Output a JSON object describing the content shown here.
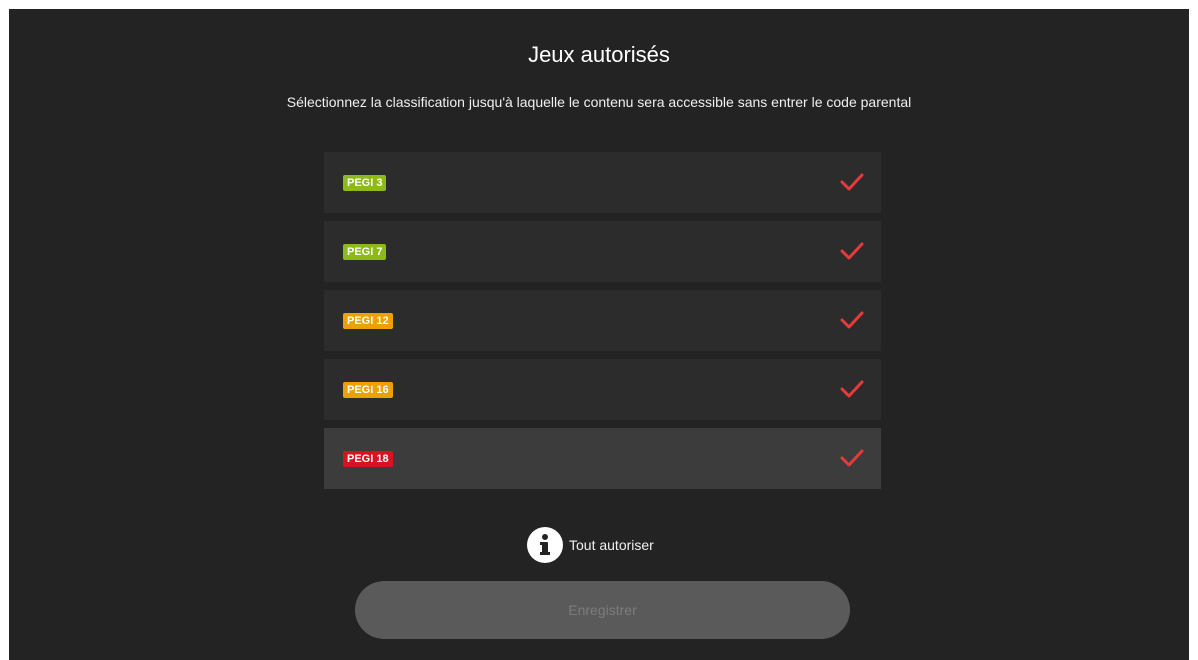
{
  "header": {
    "title": "Jeux autorisés",
    "subtitle": "Sélectionnez la classification jusqu'à laquelle le contenu sera accessible sans entrer le code parental"
  },
  "ratings": [
    {
      "label": "PEGI 3",
      "color": "#8dba18",
      "checked": true
    },
    {
      "label": "PEGI 7",
      "color": "#8dba18",
      "checked": true
    },
    {
      "label": "PEGI 12",
      "color": "#eda100",
      "checked": true
    },
    {
      "label": "PEGI 16",
      "color": "#eda100",
      "checked": true
    },
    {
      "label": "PEGI 18",
      "color": "#d8121e",
      "checked": true,
      "focused": true
    }
  ],
  "check_color": "#e83a3a",
  "allow_all": {
    "label": "Tout autoriser",
    "icon": "info-icon"
  },
  "save_button": {
    "label": "Enregistrer",
    "enabled": false
  }
}
